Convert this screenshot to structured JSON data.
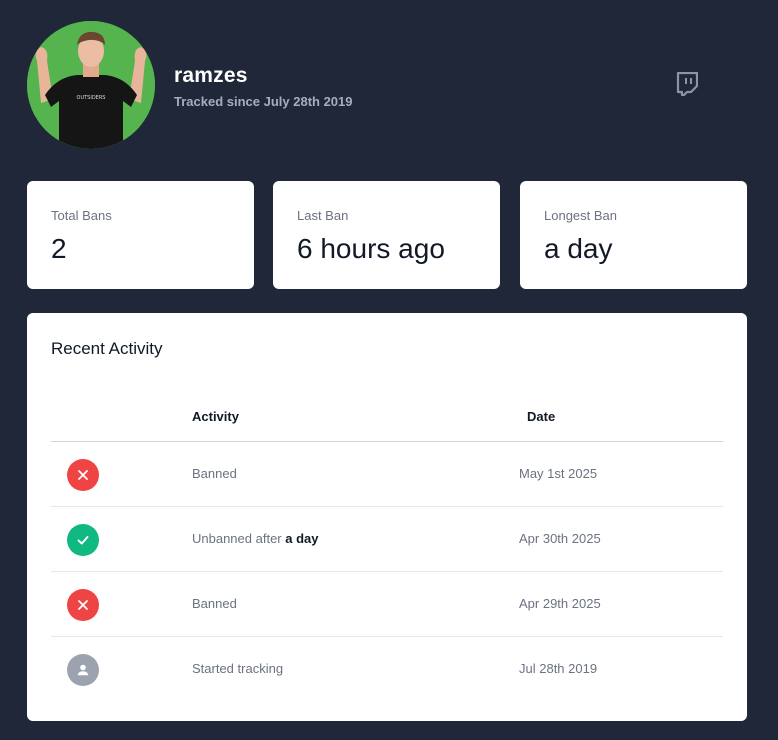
{
  "profile": {
    "username": "ramzes",
    "tracked_since": "Tracked since July 28th 2019",
    "avatar_shirt_text": "OUTSIDERS",
    "platform_icon": "twitch-icon",
    "colors": {
      "background": "#1f2738",
      "avatar_bg": "#4fb04a"
    }
  },
  "stats": [
    {
      "label": "Total Bans",
      "value": "2"
    },
    {
      "label": "Last Ban",
      "value": "6 hours ago"
    },
    {
      "label": "Longest Ban",
      "value": "a day"
    }
  ],
  "activity": {
    "title": "Recent Activity",
    "headers": {
      "activity": "Activity",
      "date": "Date"
    },
    "rows": [
      {
        "status": "banned",
        "icon": "x-icon",
        "color": "#ef4444",
        "text": "Banned",
        "emphasis": "",
        "date": "May 1st 2025"
      },
      {
        "status": "unbanned",
        "icon": "check-icon",
        "color": "#10b981",
        "text": "Unbanned after ",
        "emphasis": "a day",
        "date": "Apr 30th 2025"
      },
      {
        "status": "banned",
        "icon": "x-icon",
        "color": "#ef4444",
        "text": "Banned",
        "emphasis": "",
        "date": "Apr 29th 2025"
      },
      {
        "status": "tracking",
        "icon": "user-icon",
        "color": "#9ca3af",
        "text": "Started tracking",
        "emphasis": "",
        "date": "Jul 28th 2019"
      }
    ]
  }
}
